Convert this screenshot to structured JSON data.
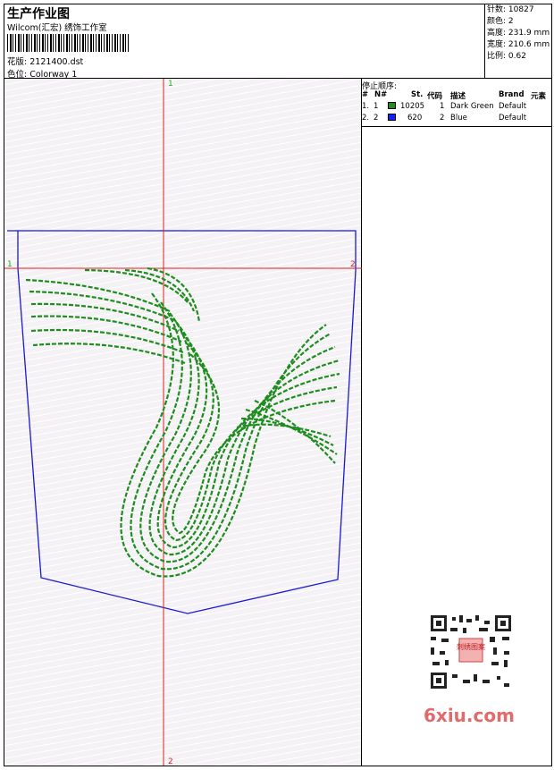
{
  "header": {
    "title": "生产作业图",
    "company": "Wilcom(汇宏) 绣饰工作室",
    "design_label": "花版:",
    "design_file": "2121400.dst",
    "colorway_label": "色位:",
    "colorway": "Colorway 1"
  },
  "stats": {
    "stitches_label": "针数:",
    "stitches": "10827",
    "colors_label": "颜色:",
    "colors": "2",
    "height_label": "高度:",
    "height": "231.9 mm",
    "width_label": "宽度:",
    "width": "210.6 mm",
    "scale_label": "比例:",
    "scale": "0.62"
  },
  "stop_sequence": {
    "title": "停止顺序:",
    "columns": [
      "#",
      "N#",
      "St.",
      "代码",
      "描述",
      "Brand",
      "元素"
    ],
    "rows": [
      {
        "index": "1.",
        "needle": "1",
        "color": "#1e8c1e",
        "stitches": "10205",
        "code": "1",
        "desc": "Dark Green",
        "brand": "Default"
      },
      {
        "index": "2.",
        "needle": "2",
        "color": "#1020ff",
        "stitches": "620",
        "code": "2",
        "desc": "Blue",
        "brand": "Default"
      }
    ]
  },
  "canvas": {
    "guide_top": "1",
    "guide_bottom": "2",
    "guide_left": "1",
    "guide_right": "2",
    "guide_color": "#e02020",
    "outline_color": "#1a1ad6",
    "design_color": "#1e8c1e"
  },
  "watermark": {
    "text": "6xiu.com",
    "qr_label": "刺绣图案"
  }
}
